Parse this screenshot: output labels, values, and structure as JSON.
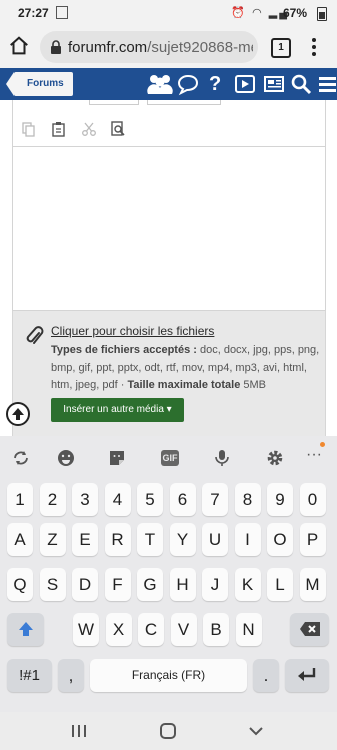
{
  "status": {
    "time": "27:27",
    "battery": "67%"
  },
  "browser": {
    "url_domain": "forumfr.com",
    "url_rest": "/sujet920868-me",
    "tab_count": "1"
  },
  "site_nav": {
    "forums_label": "Forums"
  },
  "attachments": {
    "choose_label": "Cliquer pour choisir les fichiers",
    "types_label": "Types de fichiers acceptés :",
    "types_list": " doc, docx, jpg, pps, png, bmp, gif, ppt, pptx, odt, rtf, mov, mp4, mp3, avi, html, htm, jpeg, pdf · ",
    "max_label": "Taille maximale totale",
    "max_value": " 5MB",
    "insert_button": "Insérer un autre média"
  },
  "keyboard": {
    "row_numbers": [
      "1",
      "2",
      "3",
      "4",
      "5",
      "6",
      "7",
      "8",
      "9",
      "0"
    ],
    "row1": [
      "A",
      "Z",
      "E",
      "R",
      "T",
      "Y",
      "U",
      "I",
      "O",
      "P"
    ],
    "row2": [
      "Q",
      "S",
      "D",
      "F",
      "G",
      "H",
      "J",
      "K",
      "L",
      "M"
    ],
    "row3": [
      "W",
      "X",
      "C",
      "V",
      "B",
      "N"
    ],
    "symbols_key": "!#1",
    "comma_key": ",",
    "space_label": "Français (FR)",
    "period_key": "."
  }
}
